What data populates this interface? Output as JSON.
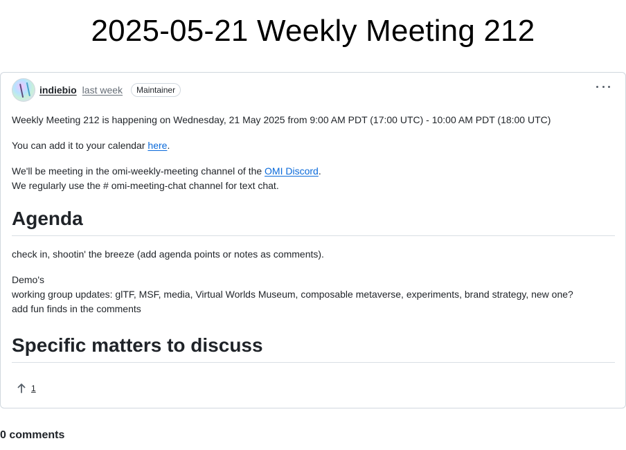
{
  "page": {
    "title": "2025-05-21 Weekly Meeting 212"
  },
  "post": {
    "author": "indiebio",
    "timestamp": "last week",
    "role_badge": "Maintainer",
    "options_icon": "kebab-horizontal-icon",
    "avatar_icon": "avatar-icon",
    "line1": "Weekly Meeting 212 is happening on Wednesday, 21 May 2025 from 9:00 AM PDT (17:00 UTC) - 10:00 AM PDT (18:00 UTC)",
    "calendar_prefix": "You can add it to your calendar ",
    "calendar_link": "here",
    "calendar_suffix": ".",
    "meeting_prefix": "We'll be meeting in the omi-weekly-meeting channel of the ",
    "discord_link": "OMI Discord",
    "meeting_suffix": ".",
    "chat_line": "We regularly use the # omi-meeting-chat channel for text chat.",
    "agenda_heading": "Agenda",
    "agenda_line1": "check in, shootin' the breeze (add agenda points or notes as comments).",
    "agenda_line2": "Demo's",
    "agenda_line3": "working group updates: glTF, MSF, media, Virtual Worlds Museum, composable metaverse, experiments, brand strategy, new one?",
    "agenda_line4": "add fun finds in the comments",
    "specific_heading": "Specific matters to discuss",
    "upvote_icon": "arrow-up-icon",
    "upvote_count": "1"
  },
  "comments": {
    "count_label": "0 comments"
  },
  "colors": {
    "link": "#0969da",
    "border": "#d0d7de",
    "muted": "#656d76",
    "text": "#1f2328"
  }
}
